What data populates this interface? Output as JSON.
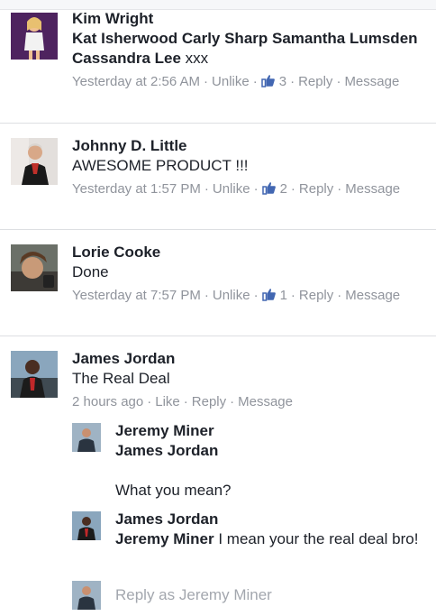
{
  "comments": [
    {
      "author": "Kim Wright",
      "text_mentions": "Kat Isherwood Carly Sharp Samantha Lumsden Cassandra Lee",
      "text_plain": " xxx",
      "time": "Yesterday at 2:56 AM",
      "like_action": "Unlike",
      "like_count": "3",
      "reply": "Reply",
      "message": "Message"
    },
    {
      "author": "Johnny D. Little",
      "text": "AWESOME PRODUCT !!!",
      "time": "Yesterday at 1:57 PM",
      "like_action": "Unlike",
      "like_count": "2",
      "reply": "Reply",
      "message": "Message"
    },
    {
      "author": "Lorie Cooke",
      "text": "Done",
      "time": "Yesterday at 7:57 PM",
      "like_action": "Unlike",
      "like_count": "1",
      "reply": "Reply",
      "message": "Message"
    },
    {
      "author": "James Jordan",
      "text": "The Real Deal",
      "time": "2 hours ago",
      "like_action": "Like",
      "reply": "Reply",
      "message": "Message"
    }
  ],
  "replies": [
    {
      "author": "Jeremy Miner",
      "mention": "James Jordan",
      "text": "What you mean?"
    },
    {
      "author": "James Jordan",
      "mention": "Jeremy Miner",
      "text": " I mean your the real deal bro!"
    }
  ],
  "reply_box": {
    "placeholder": "Reply as Jeremy Miner"
  },
  "colors": {
    "link_gray": "#90949c",
    "like_blue": "#4267b2",
    "text": "#1d2129",
    "divider": "#dddfe2"
  }
}
